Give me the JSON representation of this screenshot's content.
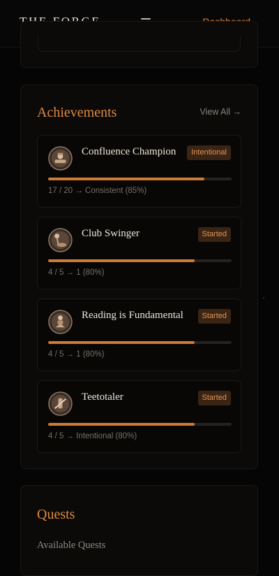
{
  "nav": {
    "brand": "THE FORGE",
    "menu_icon": "hamburger-menu-icon",
    "dashboard_link": "Dashboard"
  },
  "achievements": {
    "title": "Achievements",
    "view_all": "View All →",
    "items": [
      {
        "title": "Confluence Champion",
        "badge": "Intentional",
        "progress_text": "17 / 20 → Consistent (85%)",
        "progress": 0.85,
        "icon": "champion-medal-icon"
      },
      {
        "title": "Club Swinger",
        "badge": "Started",
        "progress_text": "4 / 5 → 1 (80%)",
        "progress": 0.8,
        "icon": "club-medal-icon"
      },
      {
        "title": "Reading is Fundamental",
        "badge": "Started",
        "progress_text": "4 / 5 → 1 (80%)",
        "progress": 0.8,
        "icon": "book-medal-icon"
      },
      {
        "title": "Teetotaler",
        "badge": "Started",
        "progress_text": "4 / 5 → Intentional (80%)",
        "progress": 0.8,
        "icon": "no-drink-medal-icon"
      }
    ]
  },
  "quests": {
    "title": "Quests",
    "available_heading": "Available Quests"
  },
  "colors": {
    "background": "#050505",
    "accent": "#d9843b",
    "progress_fill": "#d17a34",
    "badge_bg": "#3a2414"
  }
}
